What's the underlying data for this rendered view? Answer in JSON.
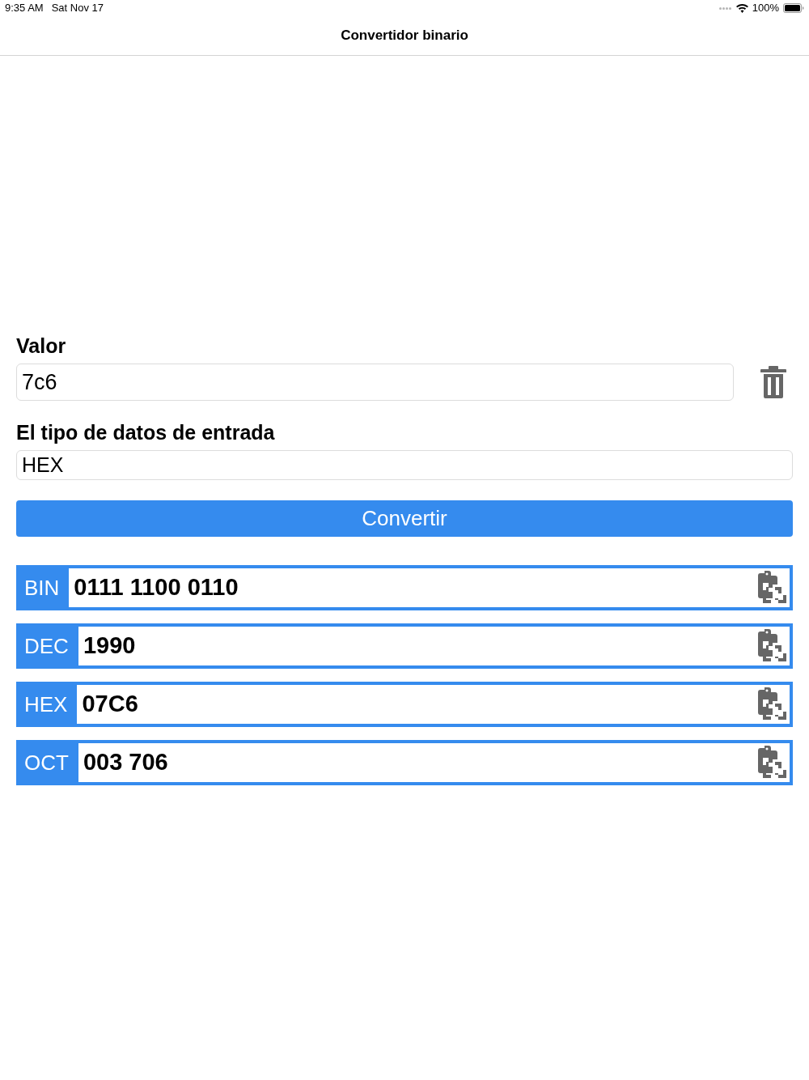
{
  "status_bar": {
    "time": "9:35 AM",
    "date": "Sat Nov 17",
    "battery": "100%"
  },
  "nav": {
    "title": "Convertidor binario"
  },
  "value_field": {
    "label": "Valor",
    "value": "7c6"
  },
  "type_field": {
    "label": "El tipo de datos de entrada",
    "value": "HEX"
  },
  "convert_button": {
    "label": "Convertir"
  },
  "results": [
    {
      "label": "BIN",
      "value": "0111 1100 0110"
    },
    {
      "label": "DEC",
      "value": "1990"
    },
    {
      "label": "HEX",
      "value": "07C6"
    },
    {
      "label": "OCT",
      "value": "003 706"
    }
  ]
}
